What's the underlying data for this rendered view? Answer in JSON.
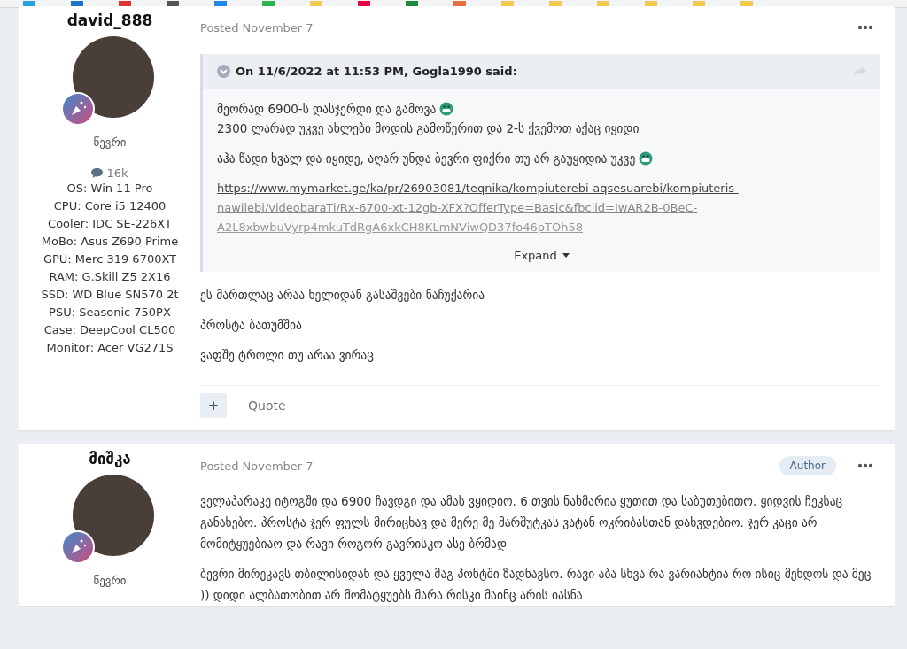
{
  "posts": [
    {
      "author": "david_888",
      "rank": "წევრი",
      "post_count": "16k",
      "specs": [
        "OS: Win 11 Pro",
        "CPU: Core i5 12400",
        "Cooler: IDC SE-226XT",
        "MoBo: Asus Z690 Prime",
        "GPU: Merc 319 6700XT",
        "RAM: G.Skill Z5 2X16",
        "SSD: WD Blue SN570 2t",
        "PSU: Seasonic 750PX",
        "Case: DeepCool CL500",
        "Monitor: Acer VG271S"
      ],
      "date": "Posted November 7",
      "quote": {
        "header": "On 11/6/2022 at 11:53 PM, Gogla1990 said:",
        "blocks": [
          {
            "kind": "text",
            "lines": [
              {
                "text": "მეორად 6900-ს დასჯერდი და გამოვა",
                "emoji": true
              },
              {
                "text": "2300 ლარად უკვე ახლები მოდის გამოწერით და 2-ს ქვემოთ აქაც იყიდი",
                "emoji": false
              }
            ]
          },
          {
            "kind": "text",
            "lines": [
              {
                "text": "აჰა წადი ხვალ და იყიდე, აღარ უნდა ბევრი ფიქრი თუ არ გაუყიდია უკვე",
                "emoji": true
              }
            ]
          },
          {
            "kind": "link",
            "lines": [
              {
                "text": "https://www.mymarket.ge/ka/pr/26903081/teqnika/kompiuterebi-aqsesuarebi/kompiuteris-"
              },
              {
                "text": "nawilebi/videobaraTi/Rx-6700-xt-12gb-XFX?OfferType=Basic&fbclid=IwAR2B-0BeC-"
              },
              {
                "text": "A2L8xbwbuVyrp4mkuTdRgA6xkCH8KLmNViwQD37fo46pTOh58"
              }
            ]
          }
        ],
        "expand": "Expand"
      },
      "paragraphs": [
        "ეს მართლაც არაა ხელიდან გასაშვები ნაჩუქარია",
        "პროსტა ბათუმშია",
        "ვაფშე ტროლი თუ არაა ვირაც"
      ],
      "plus": "+",
      "quote_action": "Quote"
    },
    {
      "author": "მიშკა",
      "rank": "წევრი",
      "date": "Posted November 7",
      "author_badge": "Author",
      "paragraphs": [
        "ველაპარაკე იტოგში და 6900 ჩავდგი და ამას ვყიდიო. 6 თვის ნახმარია ყუთით და საბუთებითო.  ყიდვის ჩეკსაც განახებო. პროსტა ჯერ ფულს მირიცხავ და მერე მე მარშუტკას ვატან ოკრიბასთან დახვდებიო. ჯერ კაცი არ მომიტყუებიაო და რავი როგორ გავრისკო ასე ბრმად",
        "ბევრი მირეკავს თბილისიდან და ყველა მაგ პონტში ზადნავსო. რავი აბა სხვა რა ვარიანტია რო ისიც მენდოს და მეც )) დიდი ალბათობით არ მომატყუებს მარა რისკი მაინც არის იასნა"
      ]
    }
  ]
}
